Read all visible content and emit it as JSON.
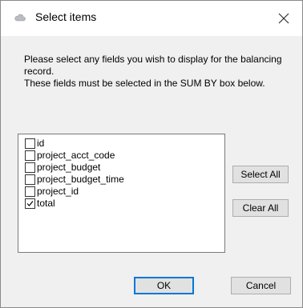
{
  "dialog": {
    "title": "Select items",
    "description_lines": [
      "Please select any fields you wish to display for the balancing record.",
      "These fields must be selected in the SUM BY box below."
    ]
  },
  "fields": [
    {
      "label": "id",
      "checked": false
    },
    {
      "label": "project_acct_code",
      "checked": false
    },
    {
      "label": "project_budget",
      "checked": false
    },
    {
      "label": "project_budget_time",
      "checked": false
    },
    {
      "label": "project_id",
      "checked": false
    },
    {
      "label": "total",
      "checked": true
    }
  ],
  "buttons": {
    "select_all": "Select All",
    "clear_all": "Clear All",
    "ok": "OK",
    "cancel": "Cancel"
  },
  "icons": {
    "title": "cloud-icon",
    "close": "close-icon"
  }
}
